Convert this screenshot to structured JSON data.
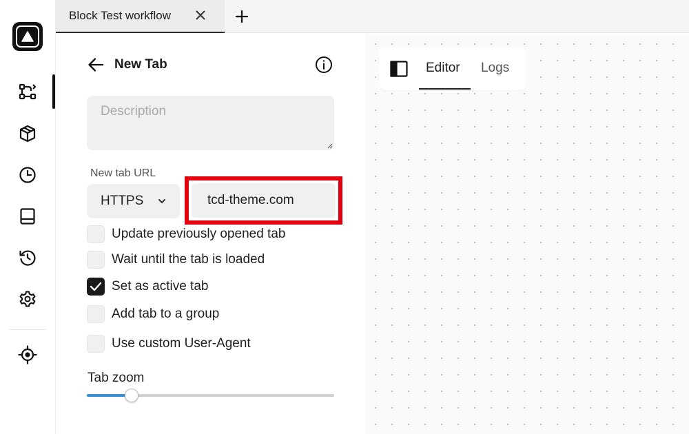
{
  "tabs": [
    {
      "label": "Block Test workflow"
    }
  ],
  "sidebar": {
    "items": [
      {
        "icon": "workflow-icon",
        "active": true
      },
      {
        "icon": "package-icon"
      },
      {
        "icon": "clock-icon"
      },
      {
        "icon": "storage-icon"
      },
      {
        "icon": "history-icon"
      },
      {
        "icon": "settings-icon"
      },
      {
        "icon": "crosshair-icon"
      }
    ]
  },
  "panel": {
    "title": "New Tab",
    "description_placeholder": "Description",
    "url_label": "New tab URL",
    "protocol": "HTTPS",
    "url_value": "tcd-theme.com",
    "options": [
      {
        "label": "Update previously opened tab",
        "checked": false
      },
      {
        "label": "Wait until the tab is loaded",
        "checked": false
      },
      {
        "label": "Set as active tab",
        "checked": true
      },
      {
        "label": "Add tab to a group",
        "checked": false
      },
      {
        "label": "Use custom User-Agent",
        "checked": false
      }
    ],
    "zoom_label": "Tab zoom",
    "zoom_level": 0.18
  },
  "editor": {
    "tabs": [
      {
        "label": "Editor",
        "active": true
      },
      {
        "label": "Logs",
        "active": false
      }
    ]
  },
  "colors": {
    "highlight": "#e2000f",
    "slider_fill": "#3b8fd9",
    "accent_dark": "#111111"
  }
}
